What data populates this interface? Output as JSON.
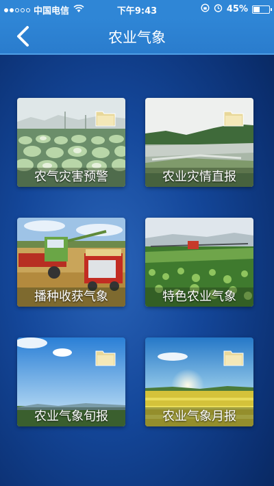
{
  "status_bar": {
    "carrier": "中国电信",
    "time": "下午9:43",
    "battery_text": "45%",
    "battery_level": 0.45
  },
  "nav": {
    "title": "农业气象",
    "back_icon": "chevron-left-icon"
  },
  "tiles": [
    {
      "label": "农气灾害预警",
      "scene": "cabbage-field",
      "has_folder_icon": true
    },
    {
      "label": "农业灾情直报",
      "scene": "flooded-field",
      "has_folder_icon": true
    },
    {
      "label": "播种收获气象",
      "scene": "harvester",
      "has_folder_icon": false
    },
    {
      "label": "特色农业气象",
      "scene": "sprayer-field",
      "has_folder_icon": false
    },
    {
      "label": "农业气象旬报",
      "scene": "blue-sky",
      "has_folder_icon": true
    },
    {
      "label": "农业气象月报",
      "scene": "sunrise-rapeseed",
      "has_folder_icon": true
    }
  ],
  "colors": {
    "nav_bar": "#2a7ccd",
    "background": "#14479a"
  }
}
